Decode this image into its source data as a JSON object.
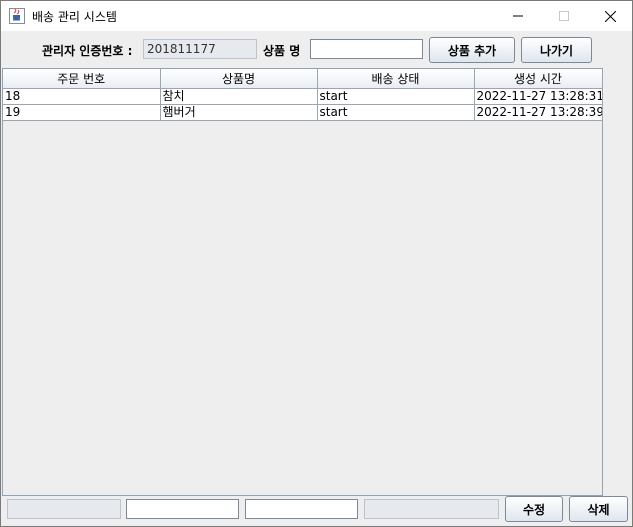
{
  "window": {
    "title": "배송 관리 시스템"
  },
  "header": {
    "admin_label": "관리자 인증번호 :",
    "admin_value": "201811177",
    "product_label": "상품 명",
    "product_value": "",
    "add_button": "상품 추가",
    "exit_button": "나가기"
  },
  "table": {
    "columns": [
      "주문 번호",
      "상품명",
      "배송 상태",
      "생성 시간"
    ],
    "rows": [
      [
        "18",
        "참치",
        "start",
        "2022-11-27 13:28:31"
      ],
      [
        "19",
        "햄버거",
        "start",
        "2022-11-27 13:28:39"
      ]
    ]
  },
  "footer": {
    "field1": "",
    "field2": "",
    "field3": "",
    "field4": "",
    "edit_button": "수정",
    "delete_button": "삭제"
  }
}
